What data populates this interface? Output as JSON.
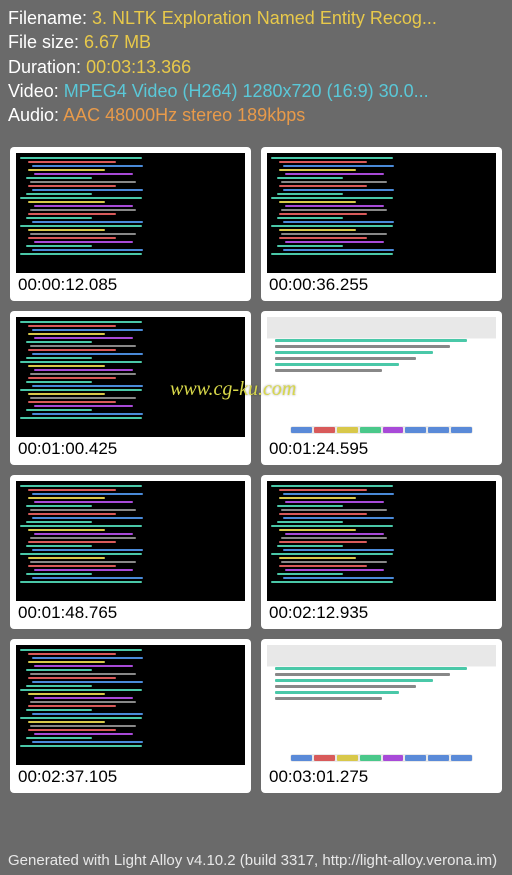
{
  "meta": {
    "filename_label": "Filename:",
    "filename_value": "3. NLTK Exploration Named Entity Recog...",
    "filesize_label": "File size:",
    "filesize_value": "6.67 MB",
    "duration_label": "Duration:",
    "duration_value": "00:03:13.366",
    "video_label": "Video:",
    "video_value": "MPEG4 Video (H264) 1280x720 (16:9) 30.0...",
    "audio_label": "Audio:",
    "audio_value": "AAC 48000Hz stereo 189kbps"
  },
  "watermark": "www.cg-ku.com",
  "thumbs": [
    {
      "ts": "00:00:12.085",
      "kind": "code"
    },
    {
      "ts": "00:00:36.255",
      "kind": "code"
    },
    {
      "ts": "00:01:00.425",
      "kind": "code"
    },
    {
      "ts": "00:01:24.595",
      "kind": "gui"
    },
    {
      "ts": "00:01:48.765",
      "kind": "code"
    },
    {
      "ts": "00:02:12.935",
      "kind": "code"
    },
    {
      "ts": "00:02:37.105",
      "kind": "code"
    },
    {
      "ts": "00:03:01.275",
      "kind": "gui"
    }
  ],
  "footer": "Generated with Light Alloy v4.10.2 (build 3317, http://light-alloy.verona.im)"
}
